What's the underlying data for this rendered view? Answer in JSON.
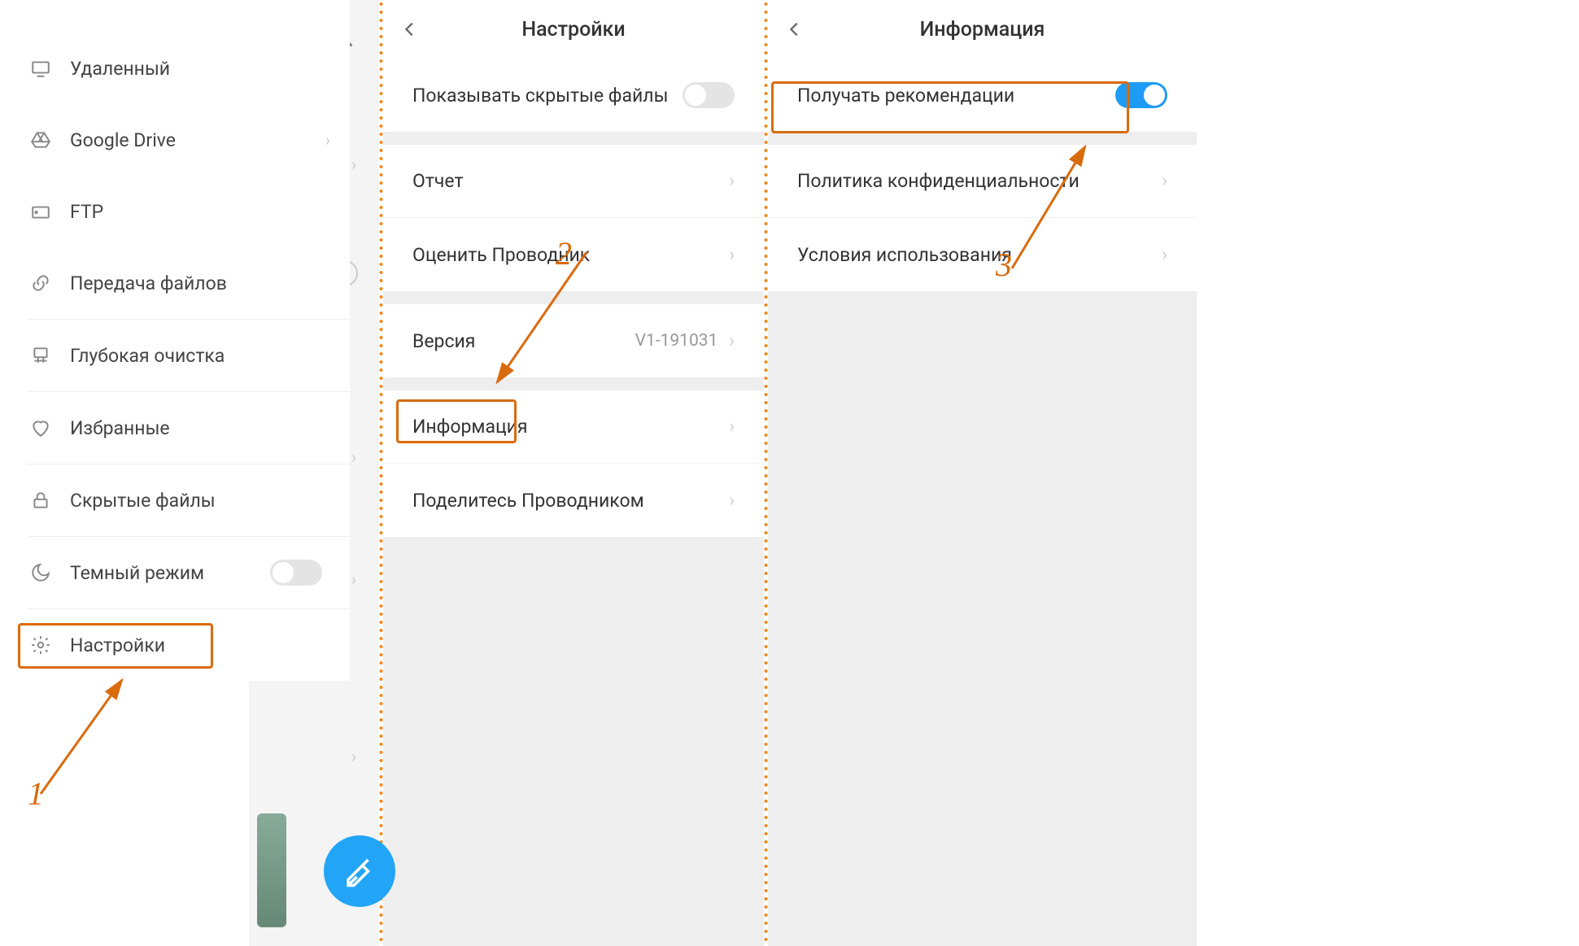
{
  "steps": {
    "one": "1",
    "two": "2",
    "three": "3"
  },
  "sidebar": {
    "items": [
      {
        "label": "Удаленный"
      },
      {
        "label": "Google Drive"
      },
      {
        "label": "FTP"
      },
      {
        "label": "Передача файлов"
      },
      {
        "label": "Глубокая очистка"
      },
      {
        "label": "Избранные"
      },
      {
        "label": "Скрытые файлы"
      },
      {
        "label": "Темный режим"
      },
      {
        "label": "Настройки"
      }
    ]
  },
  "settings": {
    "title": "Настройки",
    "hidden_files": "Показывать скрытые файлы",
    "report": "Отчет",
    "rate": "Оценить Проводник",
    "version_label": "Версия",
    "version_value": "V1-191031",
    "info": "Информация",
    "share": "Поделитесь Проводником"
  },
  "info": {
    "title": "Информация",
    "recommend": "Получать рекомендации",
    "privacy": "Политика конфиденциальности",
    "terms": "Условия использования"
  }
}
